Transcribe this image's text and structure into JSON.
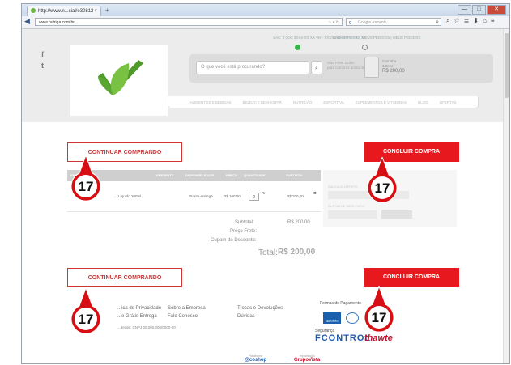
{
  "browser": {
    "tab_title": "http://www.n...cial/e30812",
    "tab_close": "×",
    "new_tab": "+",
    "url": "www.nutriga.com.br",
    "url_actions": "☆ ▾ ↻",
    "search_engine": "g",
    "search_placeholder": "Google (recent)",
    "window_buttons": [
      "—",
      "□",
      "✕"
    ],
    "nav_icons": [
      "⌕",
      "☆",
      "≣",
      "⬇",
      "⌂",
      "≡"
    ]
  },
  "header": {
    "topbar_left": "SAC: 0 (XX) 3XXX-XX XX  WH: XXXXXXXXXX XX XX XX",
    "topbar_right": "CADASTRE-SE  |  MEUS PEDIDOS  |  MEUS PEDIDOS",
    "search_placeholder": "O que você está procurando?",
    "search_icon": "⌕",
    "freight_line1": "Otto Frete Grátis",
    "freight_line2": "para compras acima de",
    "cart_line1": "Carrinho",
    "cart_line2": "1 Itens",
    "cart_total": "R$ 200,00",
    "social": [
      "f",
      "t"
    ],
    "menu": [
      "ALIMENTOS E BEBIDAS",
      "BELEZA E BEM-ESTAR",
      "NUTRIÇÃO",
      "ESPORTIVA",
      "SUPLEMENTOS E VITAMINAS",
      "BLOG",
      "OFERTAS"
    ]
  },
  "cart": {
    "continue_label": "CONTINUAR COMPRANDO",
    "conclude_label": "CONCLUIR COMPRA",
    "columns": [
      "PRODUTO",
      "PRESENTE",
      "DISPONIBILIDADE",
      "PREÇO",
      "QUANTIDADE",
      "SUBTOTAL"
    ],
    "item": {
      "name": "... Líquido 200ml",
      "availability": "Pronta entrega",
      "price": "R$ 100,00",
      "quantity": "2",
      "subtotal": "R$ 200,00"
    },
    "side_labels": [
      "CALCULE O FRETE",
      "CUPOM DE DESCONTO"
    ],
    "subtotal_label": "Subtotal:",
    "subtotal_value": "R$ 200,00",
    "freight_label": "Preço Frete:",
    "coupon_label": "Cupom de Desconto:",
    "total_label": "Total:",
    "total_value": "R$ 200,00"
  },
  "footer": {
    "col1": [
      "...ica de Privacidade",
      "...e Grátis Entrega"
    ],
    "col2": [
      "Sobre a Empresa",
      "Fale Conosco"
    ],
    "col3": [
      "Trocas e Devoluções",
      "Dúvidas"
    ],
    "cnpj": "...desde: CNPJ 00.000.000/0000-00",
    "payment_title": "Formas de Pagamento",
    "deposit_label": "DEPÓSITO",
    "security_title": "Segurança",
    "fcontrol": "FCONTROL",
    "thawte": "thawte",
    "dev_small": "Plataforma",
    "dev": "@coshop",
    "agency_small": "Implantação",
    "agency": "GrupoVista"
  },
  "annotation": {
    "number": "17"
  },
  "colors": {
    "accent_red": "#e8191e",
    "badge_red": "#d70f14",
    "brand_green": "#6cb33f"
  }
}
